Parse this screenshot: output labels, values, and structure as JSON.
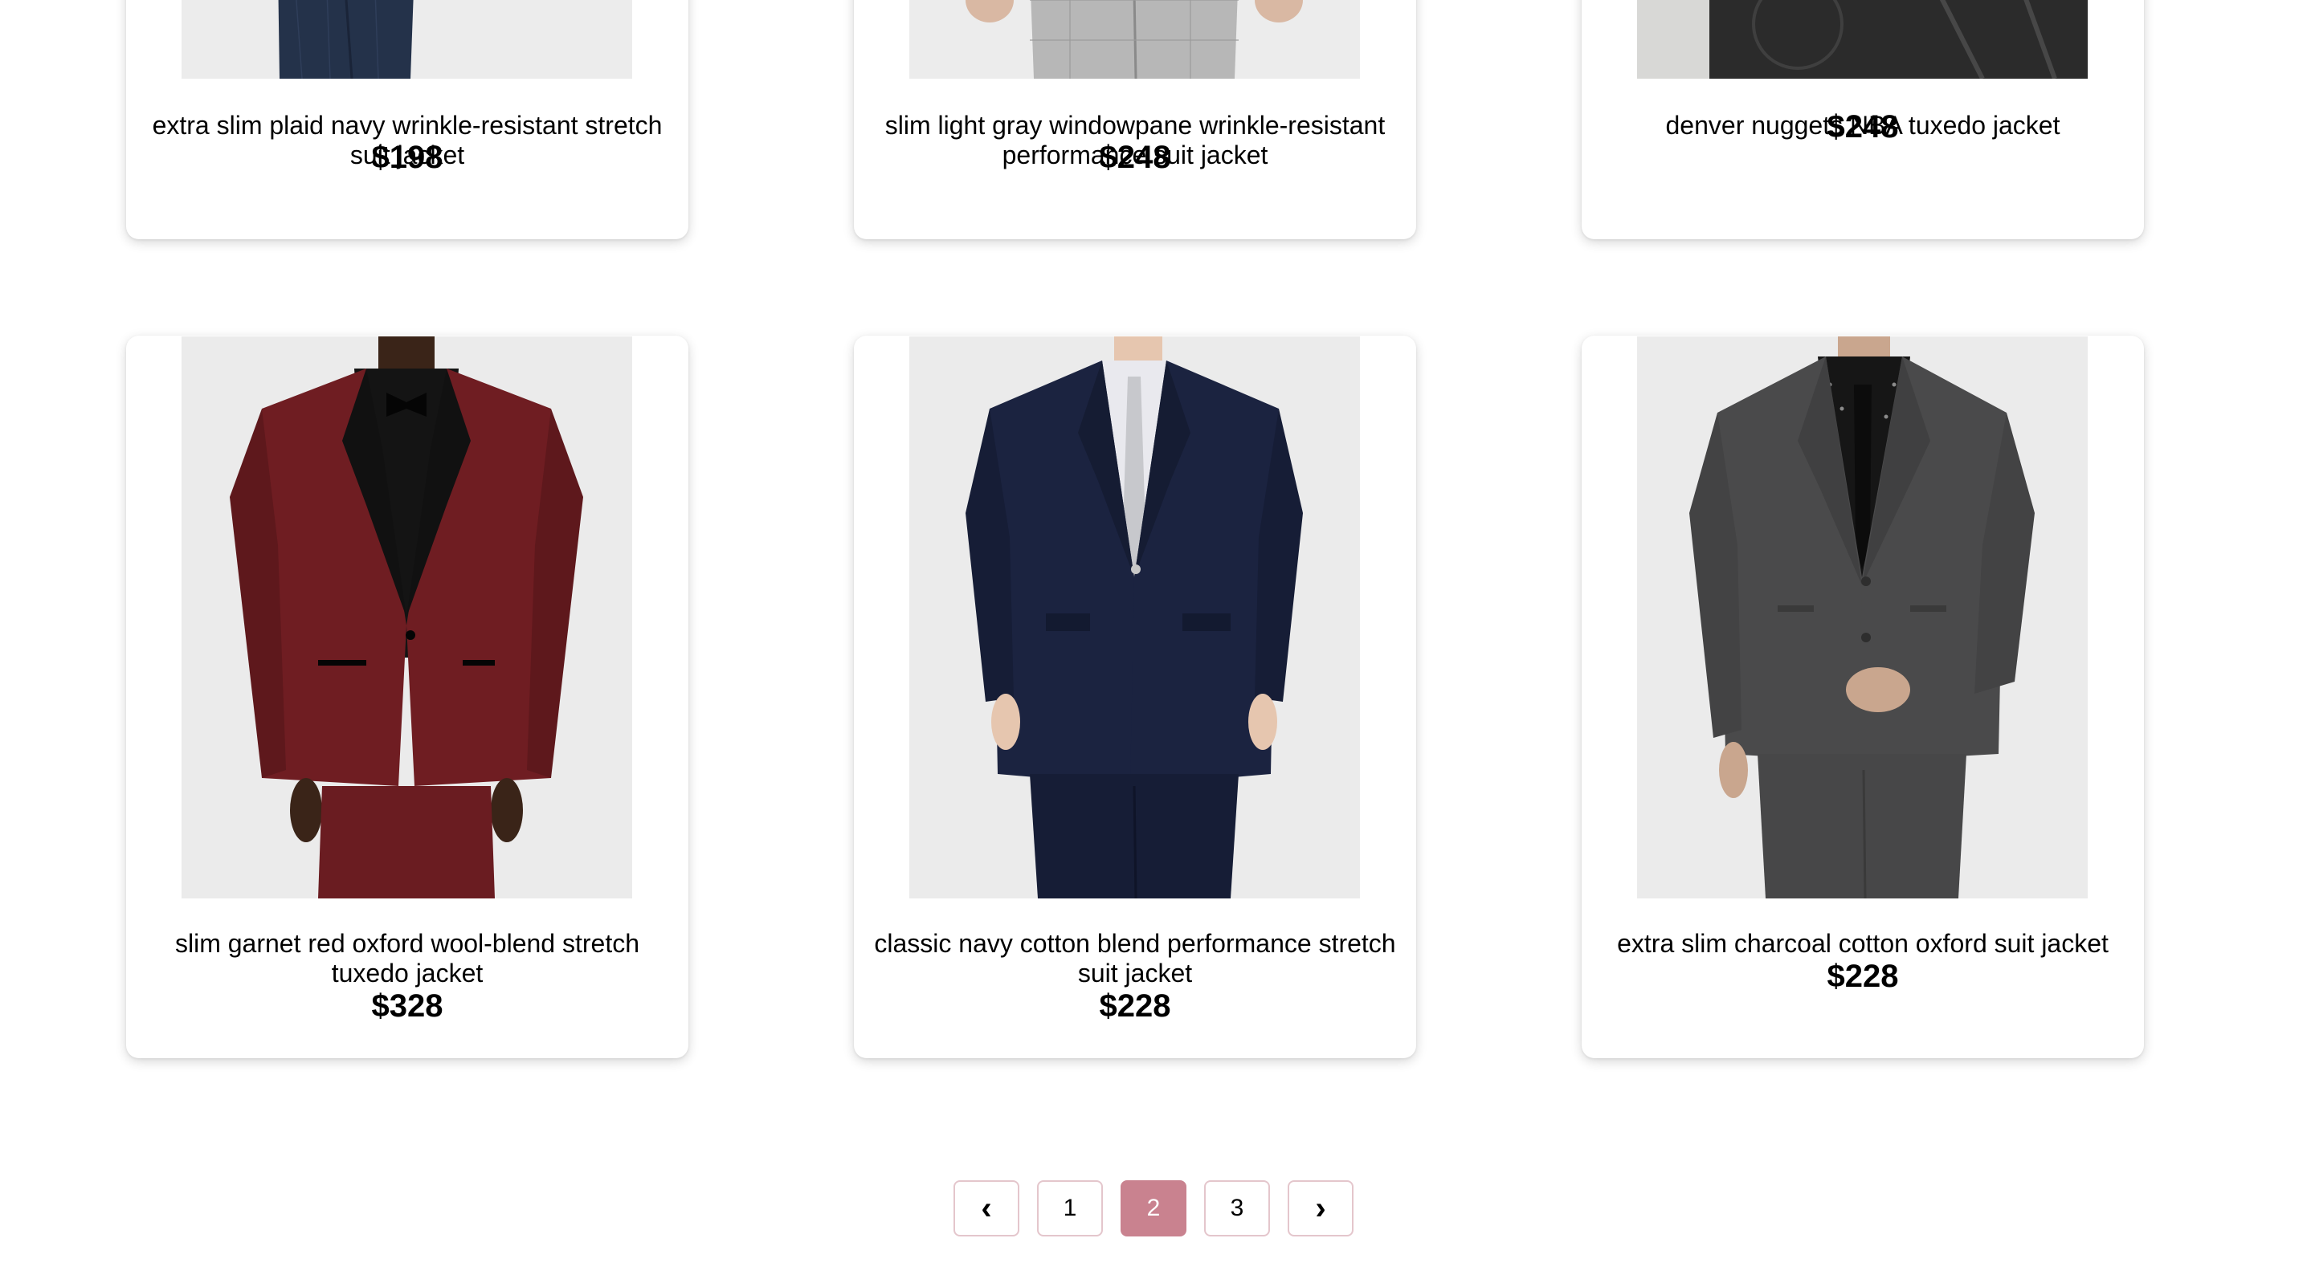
{
  "products": [
    {
      "title": "extra slim plaid navy wrinkle-resistant stretch suit jacket",
      "price": "$198",
      "image": "navy-plaid-suit-jacket"
    },
    {
      "title": "slim light gray windowpane wrinkle-resistant performance suit jacket",
      "price": "$248",
      "image": "light-gray-windowpane-suit-jacket"
    },
    {
      "title": "denver nuggets NBA tuxedo jacket",
      "price": "$248",
      "image": "nba-tuxedo-jacket"
    },
    {
      "title": "slim garnet red oxford wool-blend stretch tuxedo jacket",
      "price": "$328",
      "image": "garnet-red-tuxedo-jacket"
    },
    {
      "title": "classic navy cotton blend performance stretch suit jacket",
      "price": "$228",
      "image": "navy-suit-jacket"
    },
    {
      "title": "extra slim charcoal cotton oxford suit jacket",
      "price": "$228",
      "image": "charcoal-suit-jacket"
    }
  ],
  "pagination": {
    "prev_icon": "‹",
    "next_icon": "›",
    "pages": [
      "1",
      "2",
      "3"
    ],
    "current_page": "2",
    "active_color": "#c9828f"
  }
}
